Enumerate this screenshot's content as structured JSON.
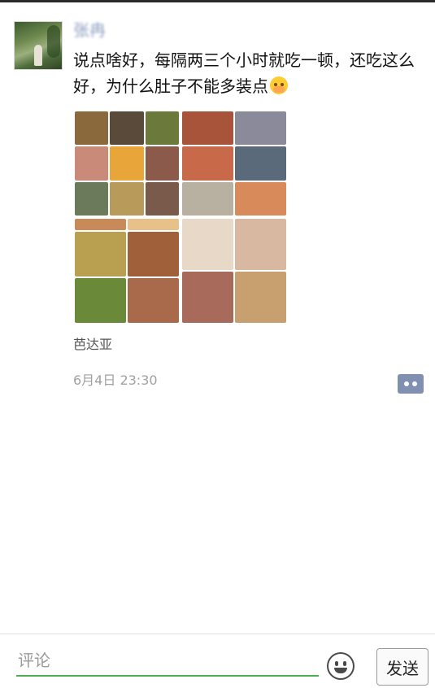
{
  "post": {
    "username": "张冉",
    "text": "说点啥好，每隔两三个小时就吃一顿，还吃这么好，为什么肚子不能多装点",
    "emoji_icon": "flushed-face-emoji",
    "location": "芭达亚",
    "timestamp": "6月4日 23:30",
    "photos": [
      {
        "icon": "food-collage-photo",
        "tiles": [
          "#8a6a3c",
          "#5a4a3a",
          "#6b7a3a",
          "#c98a7a",
          "#e8a53a",
          "#8b5a4a",
          "#6a7a5a",
          "#b89a5a",
          "#7a5a4a"
        ]
      },
      {
        "icon": "buffet-food-photo",
        "tiles": [
          "#a8543a",
          "#8a8a9a",
          "#c86a4a",
          "#5a6a7a",
          "#b8b0a0",
          "#d88a5a"
        ]
      },
      {
        "icon": "food-dishes-photo",
        "tiles": [
          "#c98a5a",
          "#e8c08a",
          "#b8a050",
          "#a0603a",
          "#6a8a3a",
          "#a86a4a"
        ]
      },
      {
        "icon": "dessert-soup-photo",
        "tiles": [
          "#e8d8c8",
          "#d8b8a0",
          "#a86a5a",
          "#c8a070"
        ]
      }
    ]
  },
  "actions": {
    "comment_button_icon": "comment-more-icon"
  },
  "composer": {
    "placeholder": "评论",
    "emoji_icon": "smiley-face-icon",
    "send_label": "发送"
  }
}
